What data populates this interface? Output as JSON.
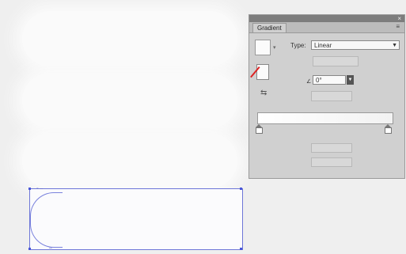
{
  "panel": {
    "tab_label": "Gradient",
    "type_label": "Type:",
    "type_value": "Linear",
    "angle_label": "∠",
    "angle_value": "0°",
    "close_glyph": "×",
    "menu_glyph": "≡"
  },
  "icons": {
    "gradient_swatch": "gradient-swatch-icon",
    "stroke_swatch": "stroke-swatch-icon",
    "reverse": "reverse-gradient-icon",
    "stop": "gradient-stop-icon"
  },
  "colors": {
    "selection": "#6d76d8",
    "panel_bg": "#d0d0d0",
    "titlebar": "#7d7d7d",
    "none_slash": "#dd2222"
  }
}
